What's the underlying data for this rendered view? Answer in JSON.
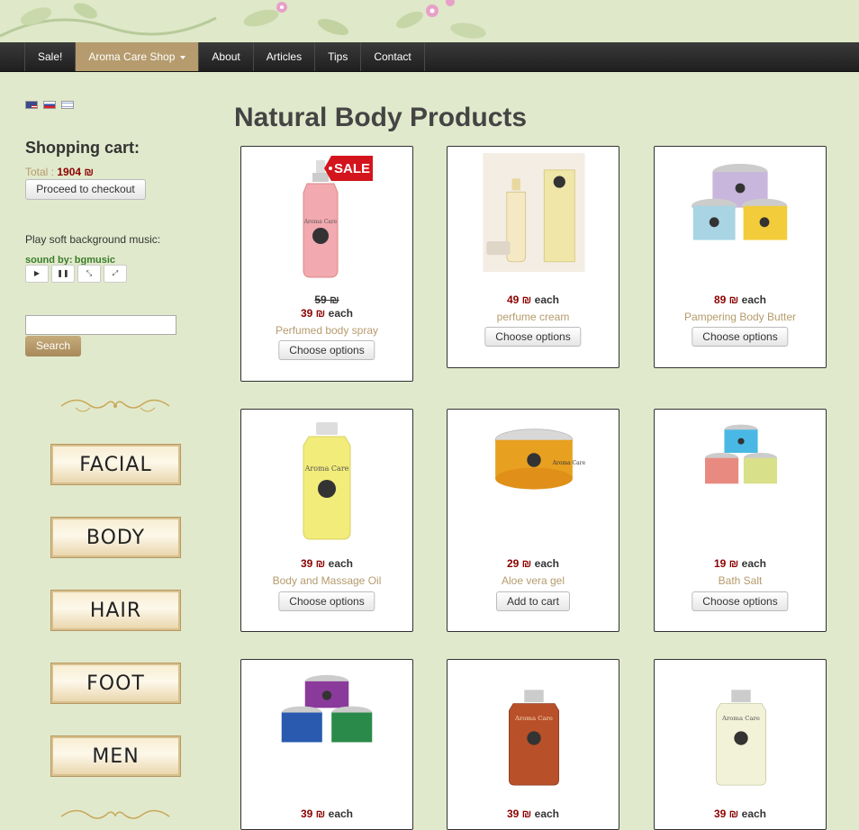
{
  "nav": {
    "items": [
      {
        "label": "Sale!"
      },
      {
        "label": "Aroma Care Shop",
        "dropdown": true
      },
      {
        "label": "About"
      },
      {
        "label": "Articles"
      },
      {
        "label": "Tips"
      },
      {
        "label": "Contact"
      }
    ],
    "active_color": "#b59b6d"
  },
  "languages": [
    "en",
    "ru",
    "he"
  ],
  "cart": {
    "title": "Shopping cart:",
    "total_label": "Total :",
    "total_value": "1904 ₪",
    "checkout_label": "Proceed to checkout"
  },
  "music": {
    "label": "Play soft background music:",
    "sound_by": "sound by:",
    "brand": "bgmusic",
    "controls": [
      "play",
      "pause",
      "shrink",
      "expand"
    ]
  },
  "search": {
    "placeholder": "",
    "button_label": "Search"
  },
  "categories": [
    "FACIAL",
    "BODY",
    "HAIR",
    "FOOT",
    "MEN"
  ],
  "main": {
    "title": "Natural Body Products"
  },
  "products": [
    {
      "old_price": "59 ₪",
      "price": "39 ₪",
      "each": "each",
      "name": "Perfumed body spray",
      "button": "Choose options",
      "sale_badge": "SALE"
    },
    {
      "price": "49 ₪",
      "each": "each",
      "name": "perfume cream",
      "button": "Choose options"
    },
    {
      "price": "89 ₪",
      "each": "each",
      "name": "Pampering Body Butter",
      "button": "Choose options"
    },
    {
      "price": "39 ₪",
      "each": "each",
      "name": "Body and Massage Oil",
      "button": "Choose options"
    },
    {
      "price": "29 ₪",
      "each": "each",
      "name": "Aloe vera gel",
      "button": "Add to cart"
    },
    {
      "price": "19 ₪",
      "each": "each",
      "name": "Bath Salt",
      "button": "Choose options"
    },
    {
      "price": "39 ₪",
      "each": "each"
    },
    {
      "price": "39 ₪",
      "each": "each"
    },
    {
      "price": "39 ₪",
      "each": "each"
    }
  ],
  "colors": {
    "background": "#e1e9cc",
    "price": "#8b0000",
    "accent_gold": "#b59b6d",
    "navbar": "#2a2a2a"
  }
}
